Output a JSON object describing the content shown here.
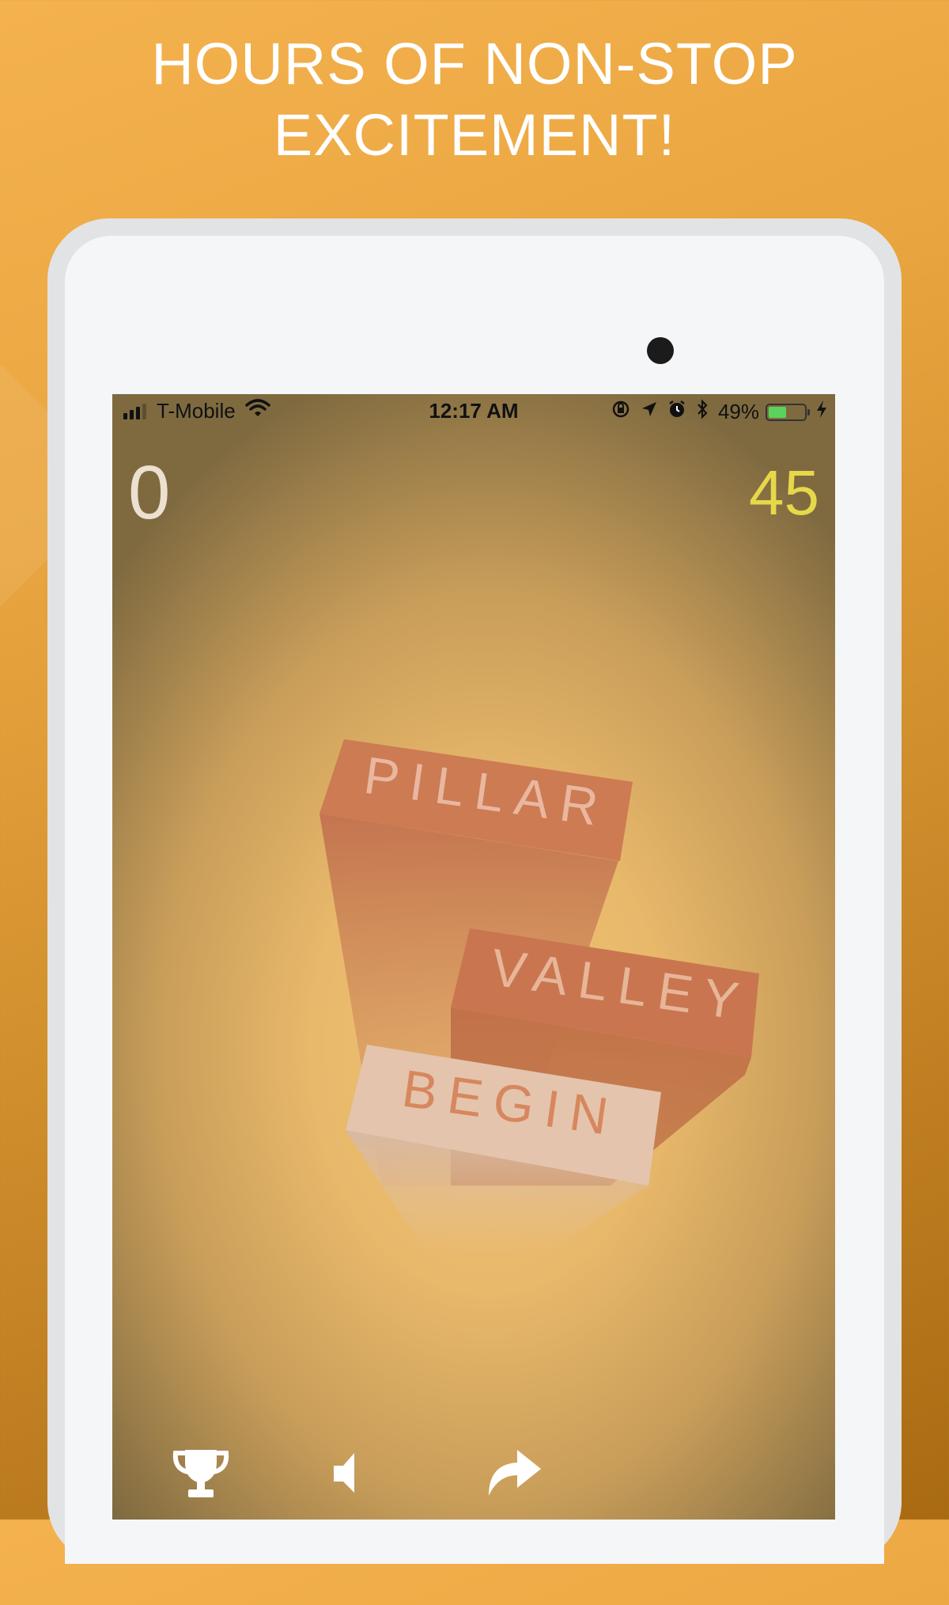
{
  "promo": {
    "headline_line1": "HOURS OF NON-STOP",
    "headline_line2": "EXCITEMENT!"
  },
  "status_bar": {
    "carrier": "T-Mobile",
    "time": "12:17 AM",
    "battery_percent": "49%",
    "battery_level": 0.49,
    "icons": [
      "signal-icon",
      "wifi-icon",
      "orientation-lock-icon",
      "location-icon",
      "alarm-icon",
      "bluetooth-icon",
      "battery-icon",
      "charging-icon"
    ]
  },
  "game": {
    "score": "0",
    "best_score": "45",
    "blocks": [
      {
        "label": "PILLAR"
      },
      {
        "label": "VALLEY"
      },
      {
        "label": "BEGIN"
      }
    ]
  },
  "toolbar": {
    "buttons": [
      "trophy-icon",
      "speaker-icon",
      "share-icon"
    ]
  },
  "colors": {
    "background_top": "#f4b24f",
    "background_bottom": "#a96a12",
    "block_orange": "#c97650",
    "block_begin": "#e4c4ad",
    "best_score": "#e7d84a",
    "score": "#ece0d0"
  }
}
